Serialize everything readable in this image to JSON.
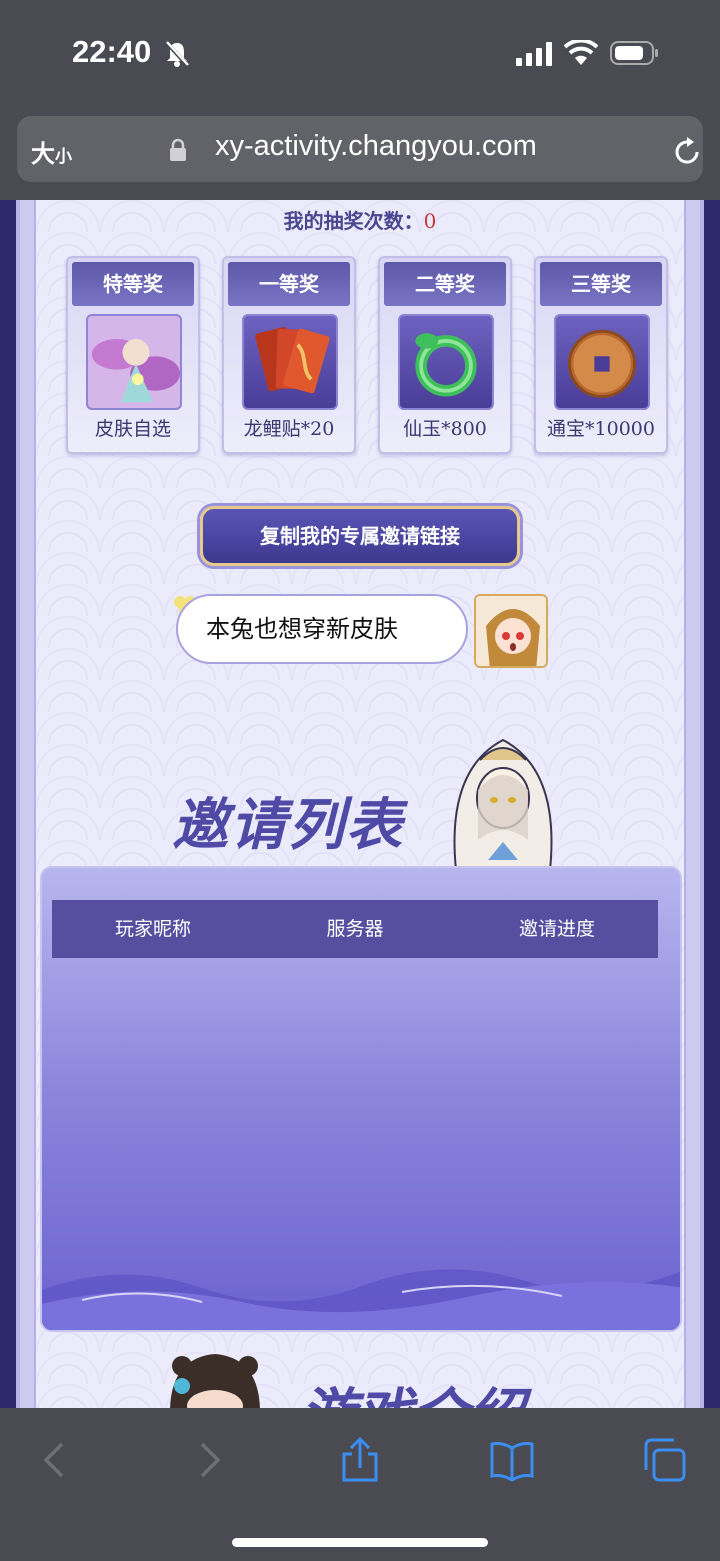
{
  "status": {
    "time": "22:40"
  },
  "browser": {
    "text_size_big": "大",
    "text_size_small": "小",
    "url": "xy-activity.changyou.com"
  },
  "lottery": {
    "label": "我的抽奖次数：",
    "count": "0"
  },
  "prizes": [
    {
      "tier": "特等奖",
      "name": "皮肤自选"
    },
    {
      "tier": "一等奖",
      "name": "龙鲤贴*20"
    },
    {
      "tier": "二等奖",
      "name": "仙玉*800"
    },
    {
      "tier": "三等奖",
      "name": "通宝*10000"
    }
  ],
  "copy_link_button": "复制我的专属邀请链接",
  "bubble_text": "本兔也想穿新皮肤",
  "invite_list": {
    "title": "邀请列表",
    "columns": [
      "玩家昵称",
      "服务器",
      "邀请进度"
    ]
  },
  "next_section_title": "游戏介绍",
  "colors": {
    "accent": "#564fa0",
    "count_red": "#c83a3a",
    "gold_border": "#e8c98c"
  }
}
